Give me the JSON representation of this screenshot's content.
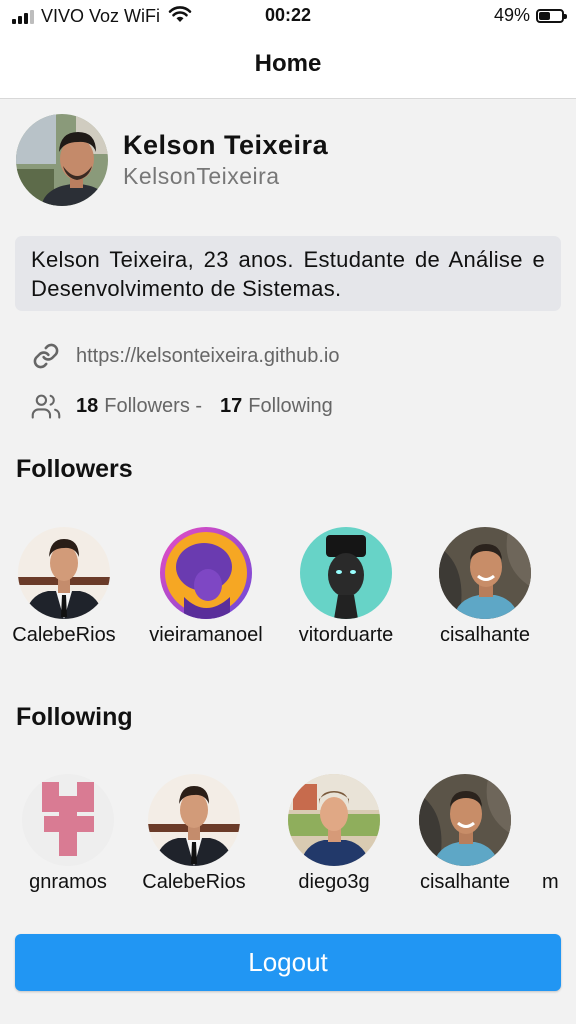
{
  "status_bar": {
    "carrier": "VIVO Voz WiFi",
    "time": "00:22",
    "battery": "49%",
    "battery_level": 0.49,
    "signal_bars": 3
  },
  "header": {
    "title": "Home"
  },
  "profile": {
    "name": "Kelson Teixeira",
    "login": "KelsonTeixeira",
    "bio": "Kelson Teixeira, 23 anos. Estudante de Análise e Desenvolvimento de Sistemas.",
    "blog": "https://kelsonteixeira.github.io",
    "followers_count": "18",
    "followers_label": "Followers -",
    "following_count": "17",
    "following_label": "Following"
  },
  "followers": {
    "title": "Followers",
    "users": [
      {
        "login": "CalebeRios"
      },
      {
        "login": "vieiramanoel"
      },
      {
        "login": "vitorduarte"
      },
      {
        "login": "cisalhante"
      }
    ]
  },
  "following": {
    "title": "Following",
    "users": [
      {
        "login": "gnramos"
      },
      {
        "login": "CalebeRios"
      },
      {
        "login": "diego3g"
      },
      {
        "login": "cisalhante"
      },
      {
        "login": "m"
      }
    ]
  },
  "logout_label": "Logout",
  "colors": {
    "accent": "#2196f3",
    "background": "#f2f2f2",
    "bio_background": "#e5e6ea",
    "muted_text": "#777777"
  },
  "icons": {
    "blog": "link-icon",
    "followers": "users-icon"
  }
}
